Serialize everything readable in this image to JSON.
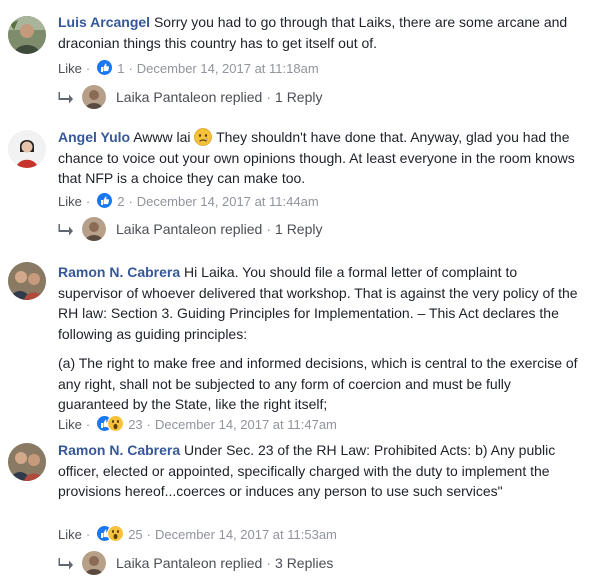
{
  "comments": [
    {
      "author": "Luis Arcangel",
      "text": "Sorry you had to go through that Laiks, there are some arcane and draconian things this country has to get itself out of.",
      "like_label": "Like",
      "reaction_count": "1",
      "timestamp": "December 14, 2017 at 11:18am",
      "reply": {
        "name": "Laika Pantaleon",
        "verb": "replied",
        "count": "1 Reply"
      }
    },
    {
      "author": "Angel Yulo",
      "text_before": "Awww lai",
      "text_after": "They shouldn't have done that. Anyway, glad you had the chance to voice out your own opinions though. At least everyone in the room knows that NFP is a choice they can make too.",
      "like_label": "Like",
      "reaction_count": "2",
      "timestamp": "December 14, 2017 at 11:44am",
      "reply": {
        "name": "Laika Pantaleon",
        "verb": "replied",
        "count": "1 Reply"
      }
    },
    {
      "author": "Ramon N. Cabrera",
      "text": "Hi Laika. You should file a formal letter of complaint to supervisor of whoever delivered that workshop. That is against the very policy of the RH law: Section 3. Guiding Principles for Implementation. – This Act declares the following as guiding principles:",
      "text2": "(a) The right to make free and informed decisions, which is central to the exercise of any right, shall not be subjected to any form of coercion and must be fully guaranteed by the State, like the right itself;",
      "like_label": "Like",
      "reaction_count": "23",
      "timestamp": "December 14, 2017 at 11:47am"
    },
    {
      "author": "Ramon N. Cabrera",
      "text": "Under Sec. 23 of the RH Law: Prohibited Acts: b) Any public officer, elected or appointed, specifically charged with the duty to implement the provisions hereof...coerces or induces any person to use such services\"",
      "like_label": "Like",
      "reaction_count": "25",
      "timestamp": "December 14, 2017 at 11:53am",
      "reply": {
        "name": "Laika Pantaleon",
        "verb": "replied",
        "count": "3 Replies"
      }
    }
  ],
  "separator": "·",
  "colors": {
    "name": "#365899",
    "like_blue": "#1877f2",
    "wow_yellow": "#f7c23a",
    "meta": "#90949c"
  },
  "icons": [
    "like-reaction-icon",
    "wow-reaction-icon",
    "sad-emoji-icon",
    "reply-arrow-icon"
  ]
}
